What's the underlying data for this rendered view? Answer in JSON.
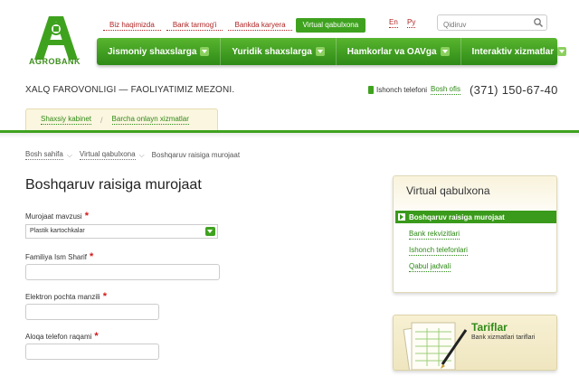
{
  "brand": {
    "name": "AGROBANK",
    "color": "#3fa21f"
  },
  "top_links": [
    "Biz haqimizda",
    "Bank tarmog'i",
    "Bankda karyera"
  ],
  "top_link_active": "Virtual qabulxona",
  "languages": [
    "En",
    "Ру"
  ],
  "search": {
    "placeholder": "Qidiruv",
    "icon": "search-icon"
  },
  "nav": [
    "Jismoniy shaxslarga",
    "Yuridik shaxslarga",
    "Hamkorlar va OAVga",
    "Interaktiv xizmatlar"
  ],
  "slogan": "XALQ FAROVONLIGI — FAOLIYATIMIZ MEZONI.",
  "trust": {
    "label": "Ishonch telefoni",
    "link": "Bosh ofis",
    "number": "(371) 150-67-40"
  },
  "sub_tabs": [
    "Shaxsiy kabinet",
    "Barcha onlayn xizmatlar"
  ],
  "breadcrumb": [
    "Bosh sahifa",
    "Virtual qabulxona",
    "Boshqaruv raisiga murojaat"
  ],
  "page_title": "Boshqaruv raisiga murojaat",
  "form": {
    "topic_label": "Murojaat mavzusi",
    "topic_value": "Plastik kartochkalar",
    "name_label": "Familiya Ism Sharif",
    "email_label": "Elektron pochta manzili",
    "phone_label": "Aloqa telefon raqami",
    "required_mark": "*"
  },
  "sidebar": {
    "title": "Virtual qabulxona",
    "active_item": "Boshqaruv raisiga murojaat",
    "items": [
      "Bank rekvizitlari",
      "Ishonch telefonlari",
      "Qabul jadvali"
    ]
  },
  "tariff": {
    "title": "Tariflar",
    "subtitle": "Bank xizmatlari tariflari"
  }
}
